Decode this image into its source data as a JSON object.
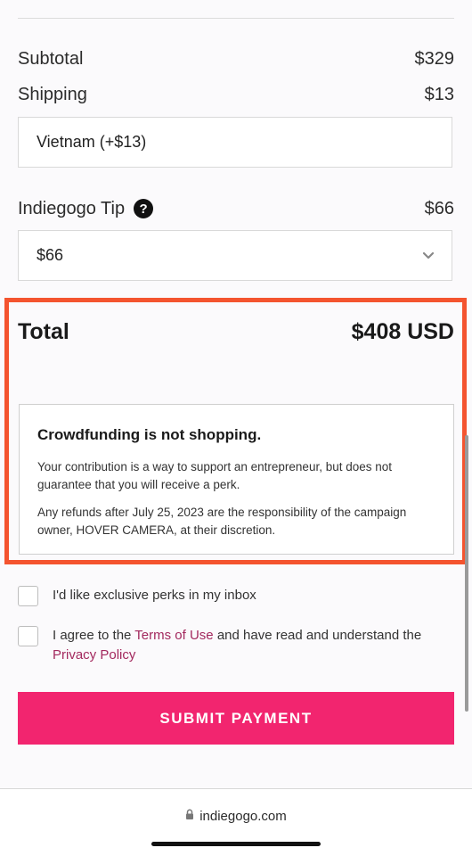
{
  "summary": {
    "subtotal_label": "Subtotal",
    "subtotal_value": "$329",
    "shipping_label": "Shipping",
    "shipping_value": "$13",
    "shipping_selection": "Vietnam (+$13)",
    "tip_label": "Indiegogo Tip",
    "tip_value": "$66",
    "tip_selection": "$66",
    "tip_help_icon": "question-icon",
    "total_label": "Total",
    "total_value": "$408 USD"
  },
  "notice": {
    "title": "Crowdfunding is not shopping.",
    "paragraph1": "Your contribution is a way to support an entrepreneur, but does not guarantee that you will receive a perk.",
    "paragraph2": "Any refunds after July 25, 2023 are the responsibility of the campaign owner, HOVER CAMERA, at their discretion."
  },
  "options": {
    "perks_label": "I'd like exclusive perks in my inbox",
    "agree_prefix": "I agree to the ",
    "terms_link": "Terms of Use",
    "agree_middle": " and have read and understand the ",
    "privacy_link": "Privacy Policy"
  },
  "submit_label": "SUBMIT PAYMENT",
  "browser": {
    "url": "indiegogo.com",
    "lock_icon": "lock-icon"
  },
  "colors": {
    "accent": "#f2256f",
    "highlight": "#f4542f",
    "link": "#a3295e"
  }
}
